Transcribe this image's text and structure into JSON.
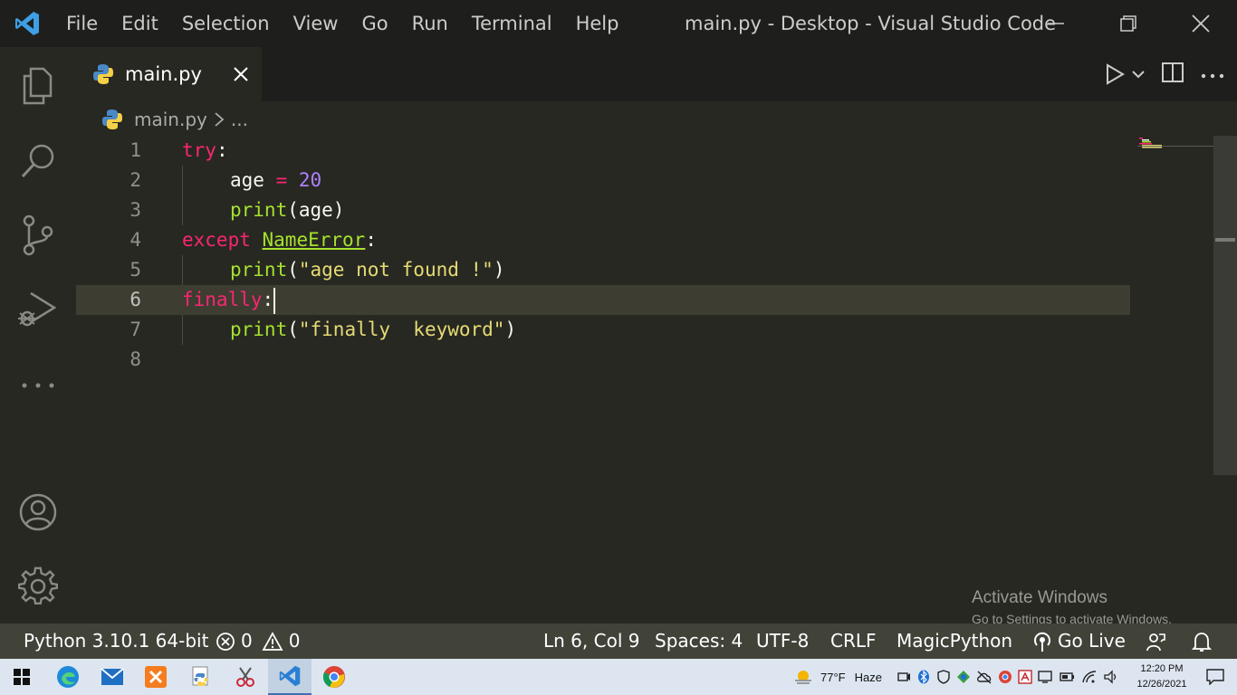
{
  "titlebar": {
    "menu": [
      "File",
      "Edit",
      "Selection",
      "View",
      "Go",
      "Run",
      "Terminal",
      "Help"
    ],
    "title": "main.py - Desktop - Visual Studio Code"
  },
  "tab": {
    "label": "main.py"
  },
  "breadcrumb": {
    "file": "main.py",
    "more": "..."
  },
  "editor": {
    "line_numbers": [
      "1",
      "2",
      "3",
      "4",
      "5",
      "6",
      "7",
      "8"
    ],
    "code": {
      "l1_kw": "try",
      "l1_punct": ":",
      "l2_var": "age",
      "l2_op": "=",
      "l2_num": "20",
      "l3_fn": "print",
      "l3_args": "(age)",
      "l4_kw": "except",
      "l4_cls": "NameError",
      "l4_punct": ":",
      "l5_fn": "print",
      "l5_open": "(",
      "l5_str": "\"age not found !\"",
      "l5_close": ")",
      "l6_kw": "finally",
      "l6_punct": ":",
      "l7_fn": "print",
      "l7_open": "(",
      "l7_str": "\"finally  keyword\"",
      "l7_close": ")"
    }
  },
  "watermark": {
    "line1": "Activate Windows",
    "line2": "Go to Settings to activate Windows."
  },
  "statusbar": {
    "interpreter": "Python 3.10.1 64-bit",
    "errors": "0",
    "warnings": "0",
    "position": "Ln 6, Col 9",
    "spaces": "Spaces: 4",
    "encoding": "UTF-8",
    "eol": "CRLF",
    "language": "MagicPython",
    "golive": "Go Live"
  },
  "taskbar": {
    "weather_temp": "77°F",
    "weather_desc": "Haze",
    "time": "12:20 PM",
    "date": "12/26/2021"
  },
  "colors": {
    "keyword": "#f92672",
    "function": "#a6e22e",
    "number": "#ae81ff",
    "string": "#e6db74",
    "editor_bg": "#272822"
  }
}
